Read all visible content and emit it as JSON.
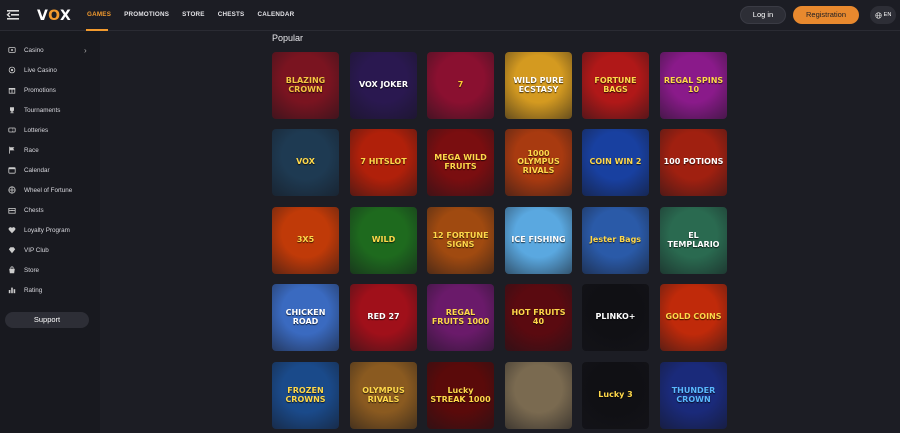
{
  "logo": {
    "v": "V",
    "o": "O",
    "x": "X"
  },
  "nav": [
    {
      "label": "GAMES",
      "active": true
    },
    {
      "label": "PROMOTIONS",
      "active": false
    },
    {
      "label": "STORE",
      "active": false
    },
    {
      "label": "CHESTS",
      "active": false
    },
    {
      "label": "CALENDAR",
      "active": false
    }
  ],
  "header": {
    "login_label": "Log in",
    "register_label": "Registration",
    "language": "EN"
  },
  "sidebar": {
    "items": [
      {
        "label": "Casino",
        "icon": "casino-icon",
        "has_chevron": true
      },
      {
        "label": "Live Casino",
        "icon": "live-casino-icon"
      },
      {
        "label": "Promotions",
        "icon": "gift-icon"
      },
      {
        "label": "Tournaments",
        "icon": "trophy-icon"
      },
      {
        "label": "Lotteries",
        "icon": "ticket-icon"
      },
      {
        "label": "Race",
        "icon": "flag-icon"
      },
      {
        "label": "Calendar",
        "icon": "calendar-icon"
      },
      {
        "label": "Wheel of Fortune",
        "icon": "wheel-icon"
      },
      {
        "label": "Chests",
        "icon": "chest-icon"
      },
      {
        "label": "Loyalty Program",
        "icon": "loyalty-icon"
      },
      {
        "label": "VIP Club",
        "icon": "diamond-icon"
      },
      {
        "label": "Store",
        "icon": "store-icon"
      },
      {
        "label": "Rating",
        "icon": "rating-icon"
      }
    ],
    "support_label": "Support"
  },
  "main": {
    "section_title": "Popular"
  },
  "games": [
    {
      "title": "BLAZING CROWN",
      "bg": "#7a1420",
      "fg": "#f5c542"
    },
    {
      "title": "VOX JOKER",
      "bg": "#2a1850",
      "fg": "#ffffff"
    },
    {
      "title": "7",
      "bg": "#8a1030",
      "fg": "#ffcc33"
    },
    {
      "title": "WILD PURE ECSTASY",
      "bg": "#d49a20",
      "fg": "#ffffff"
    },
    {
      "title": "FORTUNE BAGS",
      "bg": "#b01818",
      "fg": "#ffd84a"
    },
    {
      "title": "REGAL SPINS 10",
      "bg": "#8a1a8a",
      "fg": "#ffd84a"
    },
    {
      "title": "VOX",
      "bg": "#1e3a52",
      "fg": "#ffd84a"
    },
    {
      "title": "7 HITSLOT",
      "bg": "#b0200a",
      "fg": "#ffd84a"
    },
    {
      "title": "MEGA WILD FRUITS",
      "bg": "#7a0e10",
      "fg": "#ffd84a"
    },
    {
      "title": "1000 OLYMPUS RIVALS",
      "bg": "#a83a10",
      "fg": "#ffd84a"
    },
    {
      "title": "COIN WIN 2",
      "bg": "#1840a0",
      "fg": "#ffd84a"
    },
    {
      "title": "100 POTIONS",
      "bg": "#a02010",
      "fg": "#ffffff"
    },
    {
      "title": "3X5",
      "bg": "#c03a08",
      "fg": "#ffd84a"
    },
    {
      "title": "WILD",
      "bg": "#1e6a1e",
      "fg": "#ffd84a"
    },
    {
      "title": "12 FORTUNE SIGNS",
      "bg": "#a04a10",
      "fg": "#ffd84a"
    },
    {
      "title": "ICE FISHING",
      "bg": "#5aa8e0",
      "fg": "#ffffff"
    },
    {
      "title": "Jester Bags",
      "bg": "#2a5aa8",
      "fg": "#ffd84a"
    },
    {
      "title": "EL TEMPLARIO",
      "bg": "#2a6a50",
      "fg": "#ffffff"
    },
    {
      "title": "CHICKEN ROAD",
      "bg": "#3a6ac0",
      "fg": "#ffffff"
    },
    {
      "title": "RED 27",
      "bg": "#a0101a",
      "fg": "#ffffff"
    },
    {
      "title": "REGAL FRUITS 1000",
      "bg": "#6a1a6a",
      "fg": "#ffd84a"
    },
    {
      "title": "HOT FRUITS 40",
      "bg": "#5a0a10",
      "fg": "#ffd84a"
    },
    {
      "title": "PLINKO+",
      "bg": "#101014",
      "fg": "#ffffff"
    },
    {
      "title": "GOLD COINS",
      "bg": "#c02a0a",
      "fg": "#ffd84a"
    },
    {
      "title": "FROZEN CROWNS",
      "bg": "#1a4a8a",
      "fg": "#ffd84a"
    },
    {
      "title": "OLYMPUS RIVALS",
      "bg": "#8a5a20",
      "fg": "#ffd84a"
    },
    {
      "title": "Lucky STREAK 1000",
      "bg": "#5a0a0a",
      "fg": "#ffd84a"
    },
    {
      "title": "",
      "bg": "#7a6a50",
      "fg": "#ffffff"
    },
    {
      "title": "Lucky 3",
      "bg": "#101014",
      "fg": "#ffd84a"
    },
    {
      "title": "THUNDER CROWN",
      "bg": "#1a2a7a",
      "fg": "#5ab8ff"
    }
  ],
  "colors": {
    "accent": "#f29a2e",
    "background": "#1c1d24",
    "sidebar": "#18191f"
  }
}
